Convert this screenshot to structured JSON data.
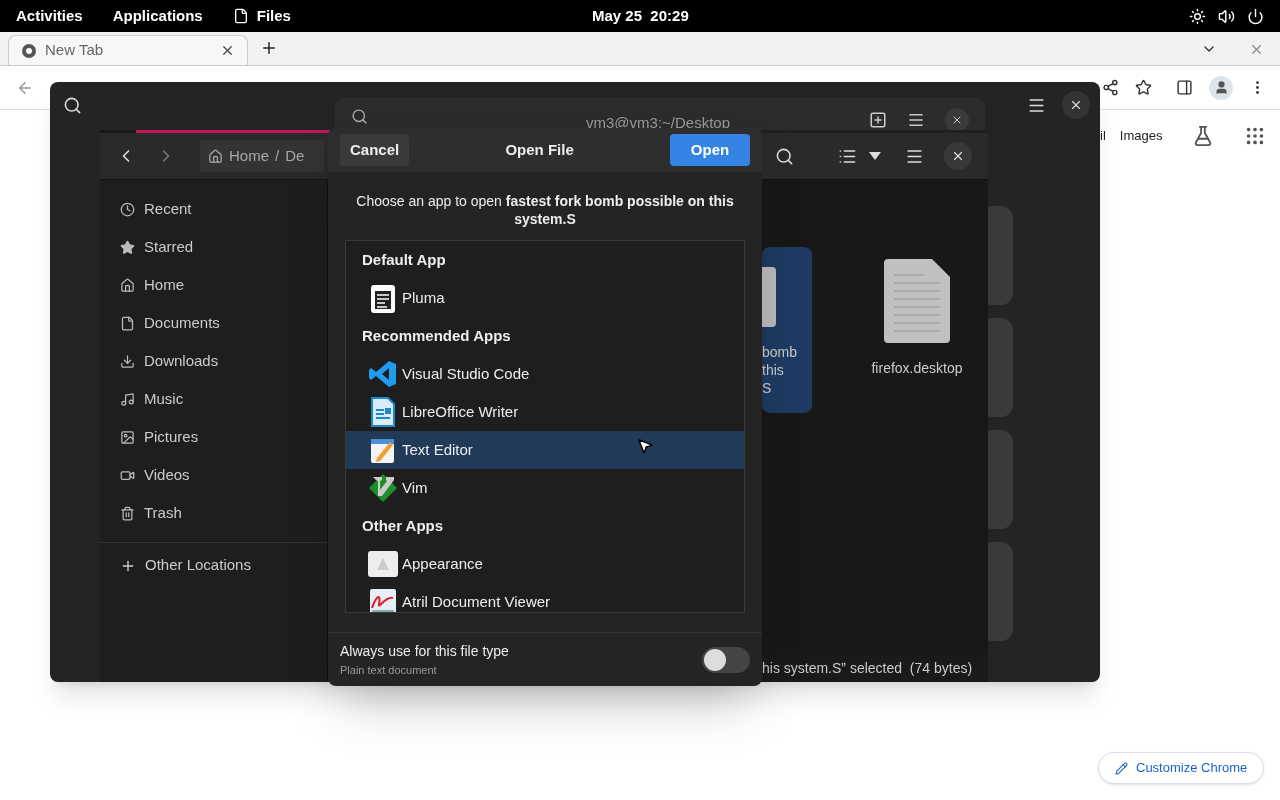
{
  "top_bar": {
    "activities": "Activities",
    "applications": "Applications",
    "app_name": "Files",
    "clock": "May 25  20:29"
  },
  "browser": {
    "tabs": [
      {
        "title": "New Tab",
        "selected": true
      }
    ],
    "links": [
      "il",
      "Images"
    ],
    "customize_button": "Customize Chrome"
  },
  "terminal": {
    "title": "vm3@vm3:~/Desktop"
  },
  "files": {
    "progress": {
      "level": 0.23
    },
    "breadcrumb": [
      {
        "label": "Home",
        "kind": "home"
      },
      {
        "label": "/",
        "kind": "separator"
      },
      {
        "label": "De",
        "kind": "folder"
      }
    ],
    "sidebar": [
      {
        "label": "Recent",
        "kind": "recent"
      },
      {
        "label": "Starred",
        "kind": "starred"
      },
      {
        "label": "Home",
        "kind": "home"
      },
      {
        "label": "Documents",
        "kind": "documents"
      },
      {
        "label": "Downloads",
        "kind": "downloads"
      },
      {
        "label": "Music",
        "kind": "music"
      },
      {
        "label": "Pictures",
        "kind": "pictures"
      },
      {
        "label": "Videos",
        "kind": "videos"
      },
      {
        "label": "Trash",
        "kind": "trash"
      }
    ],
    "other_locations": "Other Locations",
    "items": [
      {
        "lines": [
          "bomb",
          "this",
          "S"
        ],
        "selected": true
      },
      {
        "lines": [
          "firefox.desktop"
        ],
        "selected": false
      }
    ],
    "status": "his system.S” selected  (74 bytes)"
  },
  "dialog": {
    "title": "Open File",
    "cancel": "Cancel",
    "open": "Open",
    "prompt": "Choose an app to open **fastest fork bomb possible on this system.S**",
    "sections": [
      {
        "heading": "Default App",
        "apps": [
          {
            "name": "Pluma",
            "kind": "pluma",
            "selected": false
          }
        ]
      },
      {
        "heading": "Recommended Apps",
        "apps": [
          {
            "name": "Visual Studio Code",
            "kind": "vscode",
            "selected": false
          },
          {
            "name": "LibreOffice Writer",
            "kind": "writer",
            "selected": false
          },
          {
            "name": "Text Editor",
            "kind": "texteditor",
            "selected": true
          },
          {
            "name": "Vim",
            "kind": "vim",
            "selected": false
          }
        ]
      },
      {
        "heading": "Other Apps",
        "apps": [
          {
            "name": "Appearance",
            "kind": "appearance",
            "selected": false
          },
          {
            "name": "Atril Document Viewer",
            "kind": "atril",
            "selected": false
          }
        ]
      }
    ],
    "always_use": {
      "label": "Always use for this file type",
      "hint": "Plain text document",
      "on": false
    }
  }
}
